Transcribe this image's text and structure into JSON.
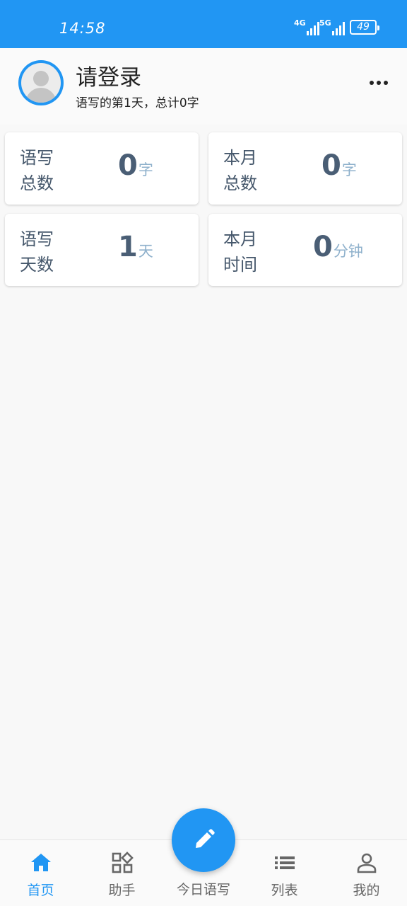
{
  "status_bar": {
    "time": "14:58",
    "signal_1": "4G",
    "signal_2": "5G",
    "battery": "49"
  },
  "header": {
    "title": "请登录",
    "subtitle": "语写的第1天，总计0字",
    "more_icon": "more-horizontal-icon"
  },
  "stats": [
    {
      "label": "语写总数",
      "value": "0",
      "unit": "字"
    },
    {
      "label": "本月总数",
      "value": "0",
      "unit": "字"
    },
    {
      "label": "语写天数",
      "value": "1",
      "unit": "天"
    },
    {
      "label": "本月时间",
      "value": "0",
      "unit": "分钟"
    }
  ],
  "nav": {
    "items": [
      {
        "label": "首页",
        "icon": "home-icon",
        "active": true
      },
      {
        "label": "助手",
        "icon": "grid-icon",
        "active": false
      },
      {
        "label": "今日语写",
        "icon": "pencil-icon",
        "active": false
      },
      {
        "label": "列表",
        "icon": "list-icon",
        "active": false
      },
      {
        "label": "我的",
        "icon": "person-icon",
        "active": false
      }
    ]
  },
  "colors": {
    "accent": "#2196f3",
    "stat_number": "#4a5e75",
    "stat_unit": "#8fb1cc",
    "label_text": "#45576b"
  }
}
